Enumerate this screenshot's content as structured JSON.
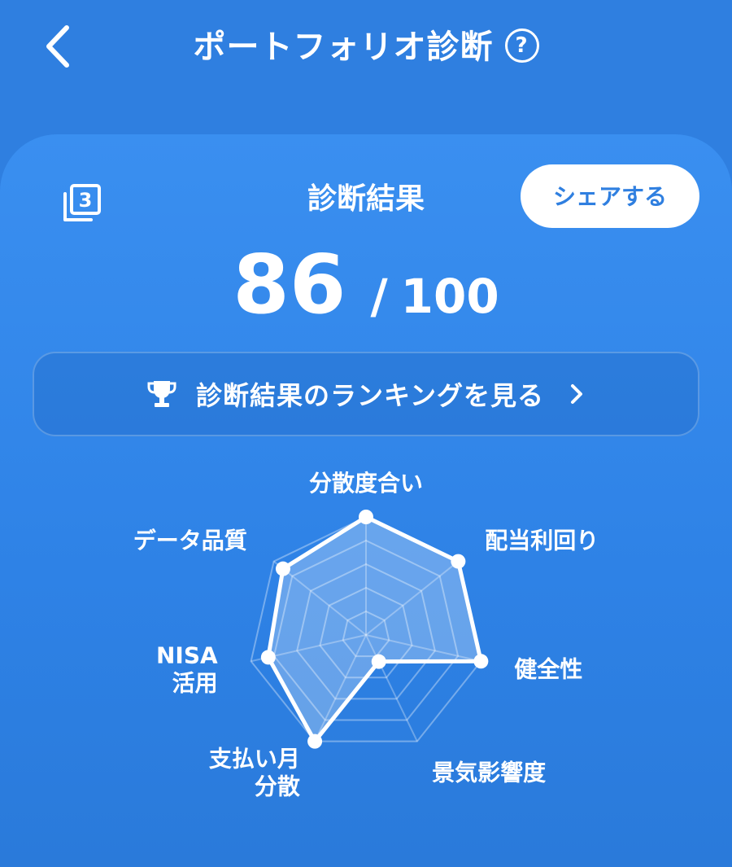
{
  "header": {
    "title": "ポートフォリオ診断",
    "help_icon": "question-circle-icon",
    "back_icon": "chevron-left-icon"
  },
  "result": {
    "title": "診断結果",
    "score": "86",
    "separator": "/",
    "max": "100",
    "share_label": "シェアする",
    "history_icon": "stacked-pages-3-icon",
    "history_count": "3"
  },
  "ranking": {
    "label": "診断結果のランキングを見る",
    "icon": "trophy-icon",
    "chevron_icon": "chevron-right-icon"
  },
  "colors": {
    "background": "#2f7fe0",
    "accent": "#2f7fe0",
    "white": "#ffffff"
  },
  "chart_data": {
    "type": "radar",
    "axes": [
      {
        "label_lines": [
          "分散度合い"
        ],
        "value": 1.0
      },
      {
        "label_lines": [
          "配当利回り"
        ],
        "value": 1.0
      },
      {
        "label_lines": [
          "健全性"
        ],
        "value": 1.0
      },
      {
        "label_lines": [
          "景気影響度"
        ],
        "value": 0.25
      },
      {
        "label_lines": [
          "支払い月",
          "分散"
        ],
        "value": 1.0
      },
      {
        "label_lines": [
          "NISA",
          "活用"
        ],
        "value": 0.85
      },
      {
        "label_lines": [
          "データ品質"
        ],
        "value": 0.9
      }
    ],
    "scale": [
      0,
      1
    ],
    "grid_levels": 5
  }
}
